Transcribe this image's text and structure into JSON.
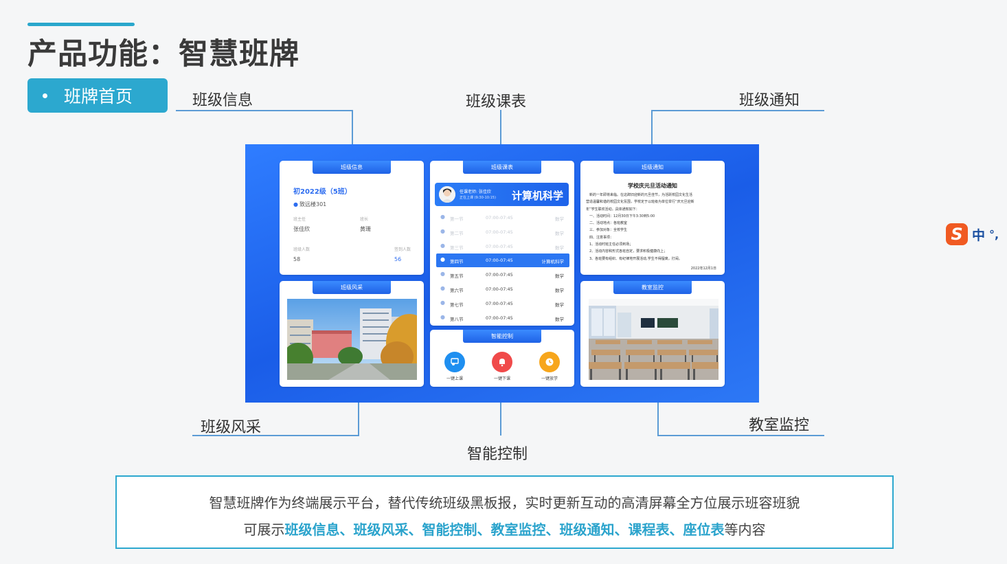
{
  "page": {
    "title": "产品功能：智慧班牌"
  },
  "section_tab": {
    "label": "班牌首页"
  },
  "callouts": {
    "class_info": "班级信息",
    "class_schedule": "班级课表",
    "class_notice": "班级通知",
    "class_style": "班级风采",
    "smart_control": "智能控制",
    "classroom_monitor": "教室监控"
  },
  "screen": {
    "class_info_card": {
      "header": "班级信息",
      "class_name": "初2022级（5班）",
      "location": "致远楼301",
      "head_teacher_label": "班主任",
      "head_teacher": "张佳欣",
      "monitor_label": "班长",
      "monitor": "黄珊",
      "class_size_label": "班级人数",
      "class_size": "58",
      "signed_label": "签到人数",
      "signed": "56"
    },
    "class_style_card": {
      "header": "班级风采"
    },
    "schedule_card": {
      "header": "班级课表",
      "teacher_line": "任课老师: 张佳欣",
      "status_line": "正在上课  (9:30-10:15)",
      "current_subject": "计算机科学",
      "rows": [
        {
          "period": "第一节",
          "time": "07:00-07:45",
          "subject": "数学",
          "state": "past"
        },
        {
          "period": "第二节",
          "time": "07:00-07:45",
          "subject": "数学",
          "state": "past"
        },
        {
          "period": "第三节",
          "time": "07:00-07:45",
          "subject": "数学",
          "state": "past"
        },
        {
          "period": "第四节",
          "time": "07:00-07:45",
          "subject": "计算机科学",
          "state": "current"
        },
        {
          "period": "第五节",
          "time": "07:00-07:45",
          "subject": "数学",
          "state": "upcoming"
        },
        {
          "period": "第六节",
          "time": "07:00-07:45",
          "subject": "数学",
          "state": "upcoming"
        },
        {
          "period": "第七节",
          "time": "07:00-07:45",
          "subject": "数学",
          "state": "upcoming"
        },
        {
          "period": "第八节",
          "time": "07:00-07:45",
          "subject": "数学",
          "state": "upcoming"
        }
      ]
    },
    "control_card": {
      "header": "智能控制",
      "buttons": [
        {
          "label": "一键上课",
          "icon": "class-start-icon",
          "color": "#1f8ff0"
        },
        {
          "label": "一键下课",
          "icon": "bell-icon",
          "color": "#f04a4a"
        },
        {
          "label": "一键放学",
          "icon": "clock-icon",
          "color": "#f7a61c"
        }
      ]
    },
    "notice_card": {
      "header": "班级通知",
      "title": "学校庆元旦活动通知",
      "lines": [
        "　新的一年即将来临。在这辞旧迎新的元旦佳节，为活跃校园文化生活",
        "营造温馨和谐的校园文化氛围，学校定于以班级为单位举行“庆元旦迎新",
        "年”学生联欢活动。具体通知如下：",
        "　一、活动时间：12月30日下午3:30到5:00",
        "　二、活动地点：各班教室",
        "　三、参加对象：全校学生",
        "　四、注意事项：",
        "　1、活动时班主任必须到场；",
        "　2、活动内容和形式各班自定，要求积极健康向上；",
        "　3、各班要有组织、有纪律地开展活动,学生不得擅离，打闹。"
      ],
      "date": "2022年12月1日"
    },
    "monitor_card": {
      "header": "教室监控"
    }
  },
  "summary": {
    "line1": "智慧班牌作为终端展示平台，替代传统班级黑板报，实时更新互动的高清屏幕全方位展示班容班貌",
    "line2_prefix": "可展示",
    "highlights": [
      "班级信息",
      "班级风采",
      "智能控制",
      "教室监控",
      "班级通知",
      "课程表",
      "座位表"
    ],
    "separator": "、",
    "line2_suffix": "等内容"
  },
  "ime": {
    "mode": "中",
    "punct": "°,"
  }
}
